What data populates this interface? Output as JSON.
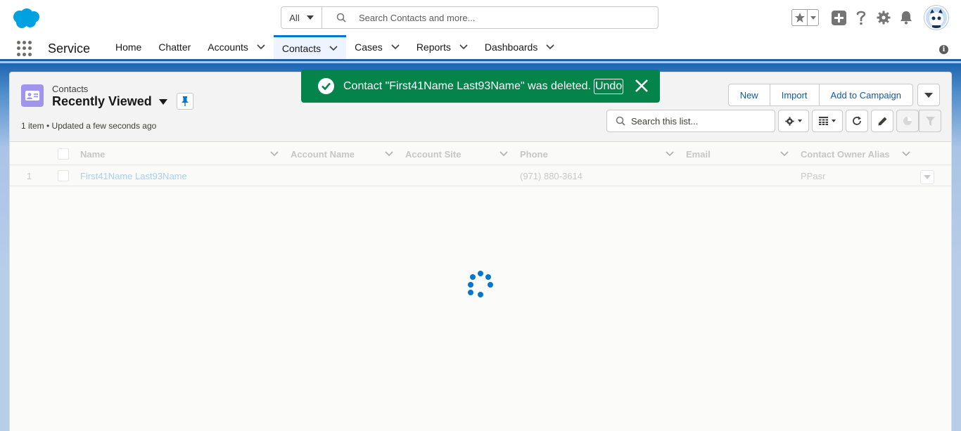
{
  "header": {
    "logo": "salesforce-cloud-logo",
    "search": {
      "scope_label": "All",
      "placeholder": "Search Contacts and more..."
    },
    "icons": [
      "favorites-star-icon",
      "add-icon",
      "help-icon",
      "setup-gear-icon",
      "notifications-bell-icon",
      "avatar"
    ]
  },
  "nav": {
    "app_name": "Service",
    "items": [
      {
        "label": "Home",
        "has_menu": false,
        "active": false
      },
      {
        "label": "Chatter",
        "has_menu": false,
        "active": false
      },
      {
        "label": "Accounts",
        "has_menu": true,
        "active": false
      },
      {
        "label": "Contacts",
        "has_menu": true,
        "active": true
      },
      {
        "label": "Cases",
        "has_menu": true,
        "active": false
      },
      {
        "label": "Reports",
        "has_menu": true,
        "active": false
      },
      {
        "label": "Dashboards",
        "has_menu": true,
        "active": false
      }
    ]
  },
  "list_view": {
    "object_label": "Contacts",
    "title": "Recently Viewed",
    "status": "1 item • Updated a few seconds ago",
    "buttons": [
      "New",
      "Import",
      "Add to Campaign"
    ],
    "search_placeholder": "Search this list...",
    "columns": [
      "Name",
      "Account Name",
      "Account Site",
      "Phone",
      "Email",
      "Contact Owner Alias"
    ],
    "rows": [
      {
        "num": "1",
        "name": "First41Name Last93Name",
        "account_name": "",
        "account_site": "",
        "phone": "(971) 880-3614",
        "email": "",
        "owner_alias": "PPasr"
      }
    ]
  },
  "toast": {
    "message": "Contact \"First41Name Last93Name\" was deleted.",
    "undo_label": "Undo",
    "color": "#04844b"
  },
  "colors": {
    "brand_blue": "#0176d3",
    "link_blue": "#0b5cab",
    "success_green": "#04844b",
    "contact_icon_purple": "#a094ed"
  }
}
